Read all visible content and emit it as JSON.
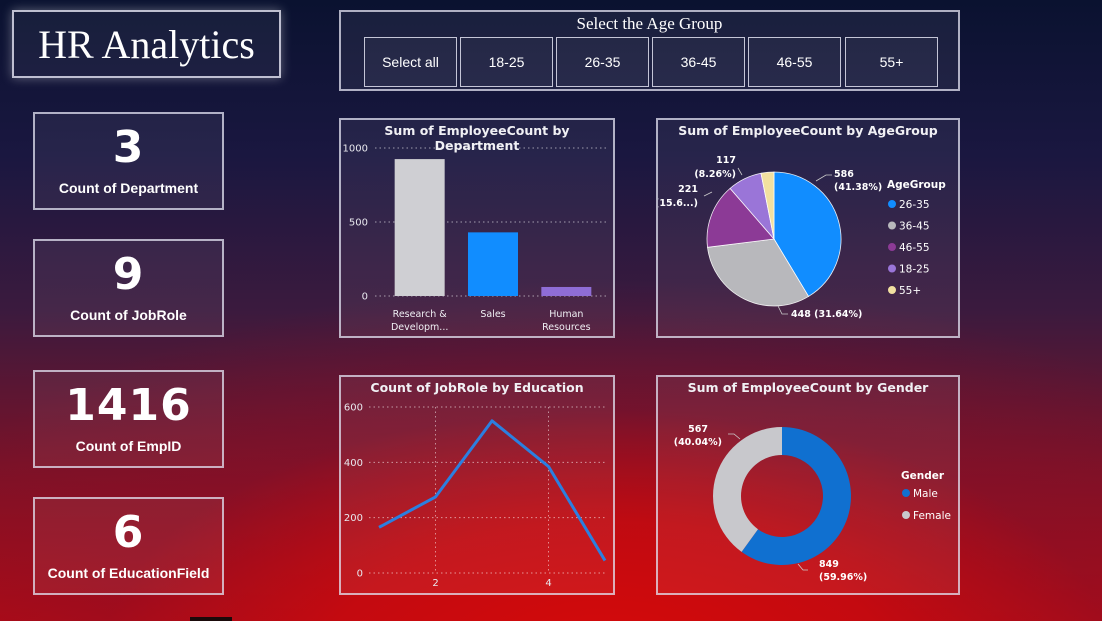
{
  "title": "HR Analytics",
  "kpis": [
    {
      "value": "3",
      "label": "Count of Department"
    },
    {
      "value": "9",
      "label": "Count of JobRole"
    },
    {
      "value": "1416",
      "label": "Count of EmpID"
    },
    {
      "value": "6",
      "label": "Count of EducationField"
    }
  ],
  "slicer": {
    "title": "Select the Age Group",
    "options": [
      "Select all",
      "18-25",
      "26-35",
      "36-45",
      "46-55",
      "55+"
    ]
  },
  "chart_data": [
    {
      "type": "bar",
      "title": "Sum of EmployeeCount by Department",
      "categories": [
        "Research & Developm...",
        "Sales",
        "Human Resources"
      ],
      "category_lines": [
        [
          "Research &",
          "Developm..."
        ],
        [
          "Sales"
        ],
        [
          "Human",
          "Resources"
        ]
      ],
      "values": [
        925,
        430,
        61
      ],
      "colors": [
        "#cfcfd3",
        "#118dff",
        "#8f6dd6"
      ],
      "ylim": [
        0,
        1000
      ],
      "yticks": [
        "0",
        "500",
        "1000"
      ],
      "grid": true
    },
    {
      "type": "pie",
      "title": "Sum of EmployeeCount by AgeGroup",
      "legend_title": "AgeGroup",
      "legend_position": "right",
      "slices": [
        {
          "name": "26-35",
          "value": 586,
          "label": "586",
          "pct": "(41.38%)",
          "color": "#118dff"
        },
        {
          "name": "36-45",
          "value": 448,
          "label": "448 (31.64%)",
          "pct": "",
          "color": "#b8b8bc"
        },
        {
          "name": "46-55",
          "value": 221,
          "label": "221",
          "pct": "(15.6...)",
          "color": "#8c3a96"
        },
        {
          "name": "18-25",
          "value": 117,
          "label": "117",
          "pct": "(8.26%)",
          "color": "#9a75d8"
        },
        {
          "name": "55+",
          "value": 44,
          "label": "",
          "pct": "",
          "color": "#f2e0a0"
        }
      ]
    },
    {
      "type": "line",
      "title": "Count of JobRole by Education",
      "x": [
        1,
        2,
        3,
        4,
        5
      ],
      "y": [
        165,
        275,
        550,
        385,
        45
      ],
      "xlim": [
        1,
        5
      ],
      "ylim": [
        0,
        600
      ],
      "xticks": [
        "2",
        "4"
      ],
      "yticks": [
        "0",
        "200",
        "400",
        "600"
      ],
      "color": "#2b7fe0",
      "grid": true
    },
    {
      "type": "pie",
      "donut": true,
      "title": "Sum of EmployeeCount by Gender",
      "legend_title": "Gender",
      "legend_position": "right",
      "slices": [
        {
          "name": "Male",
          "value": 849,
          "label": "849",
          "pct": "(59.96%)",
          "color": "#1070d0"
        },
        {
          "name": "Female",
          "value": 567,
          "label": "567",
          "pct": "(40.04%)",
          "color": "#c8c8cc"
        }
      ]
    }
  ]
}
